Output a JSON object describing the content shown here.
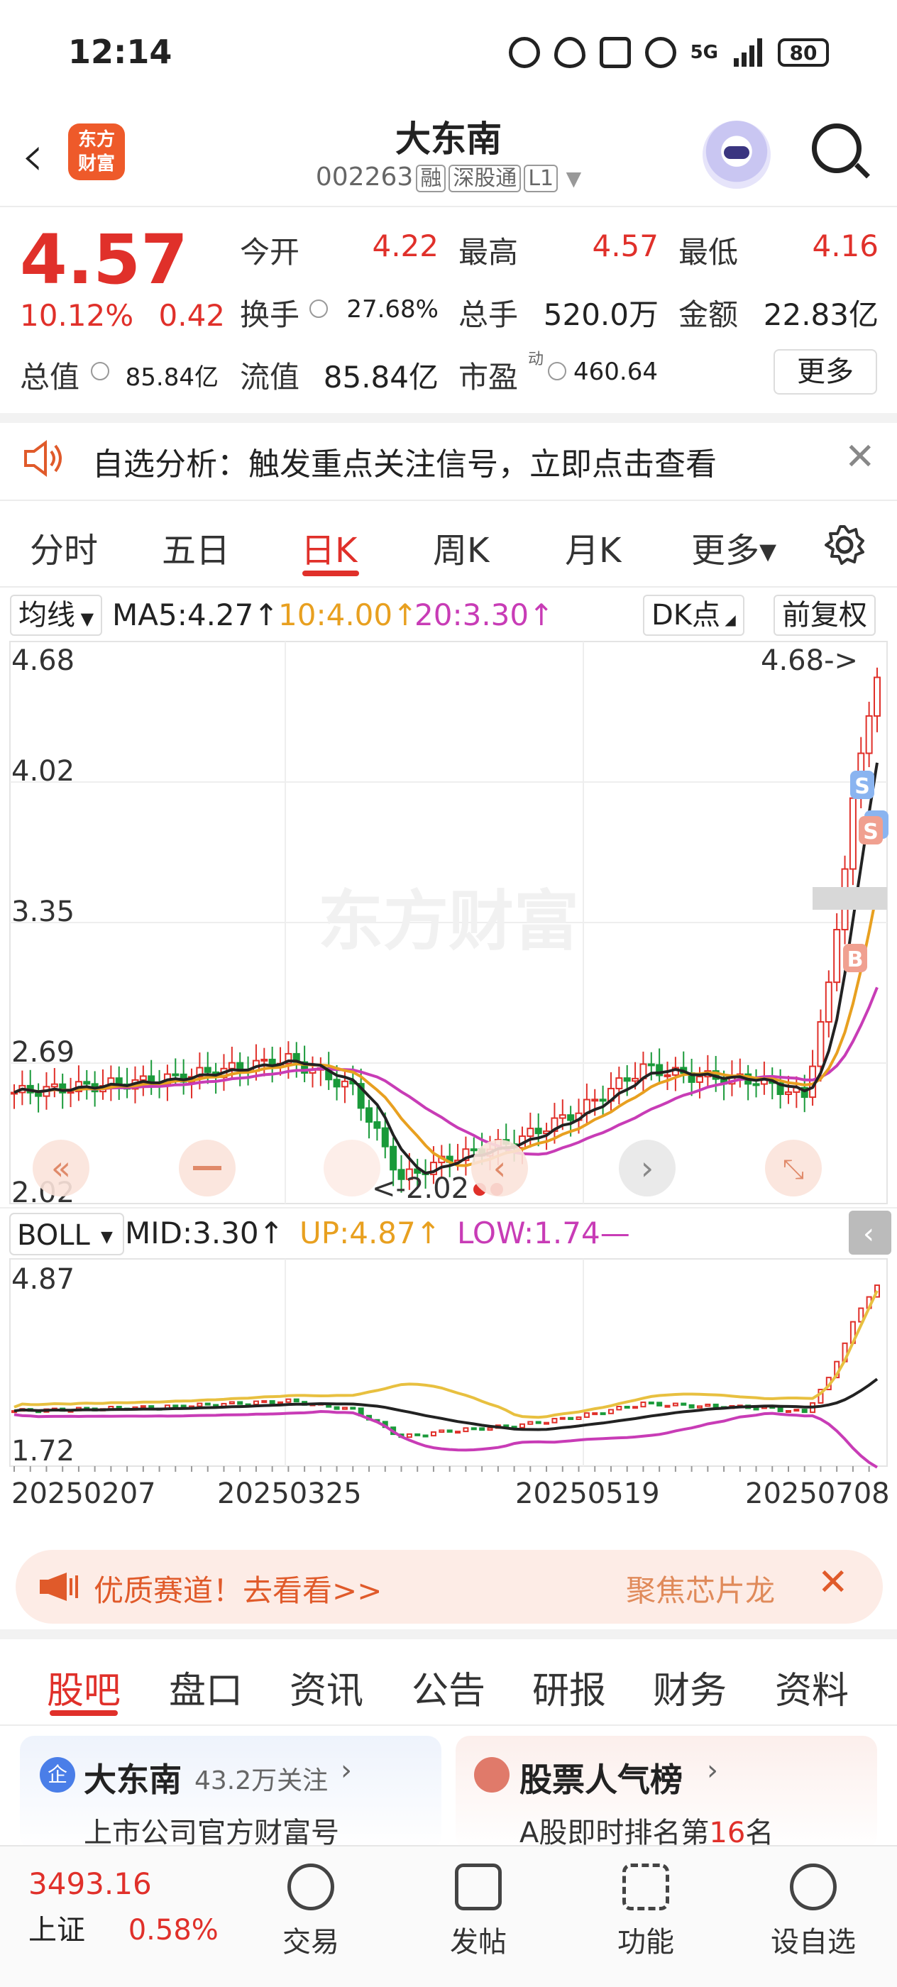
{
  "status_bar": {
    "time": "12:14",
    "network": "5G",
    "battery": "80"
  },
  "header": {
    "back_icon": "chevron-left-icon",
    "logo_line1": "东方",
    "logo_line2": "财富",
    "stock_name": "大东南",
    "stock_code": "002263",
    "tags": [
      "融",
      "深股通",
      "L1"
    ]
  },
  "quote": {
    "price": "4.57",
    "change_pct": "10.12%",
    "change_amt": "0.42",
    "open_label": "今开",
    "open": "4.22",
    "high_label": "最高",
    "high": "4.57",
    "low_label": "最低",
    "low": "4.16",
    "turnover_label": "换手",
    "turnover": "27.68%",
    "volume_label": "总手",
    "volume": "520.0万",
    "amount_label": "金额",
    "amount": "22.83亿",
    "mktcap_label": "总值",
    "mktcap": "85.84亿",
    "float_label": "流值",
    "float": "85.84亿",
    "pe_label": "市盈",
    "pe_sup": "动",
    "pe": "460.64",
    "more_label": "更多"
  },
  "alert": {
    "text": "自选分析：触发重点关注信号，立即点击查看"
  },
  "tabs": [
    "分时",
    "五日",
    "日K",
    "周K",
    "月K",
    "更多▾"
  ],
  "chart_toolbar": {
    "ma_select": "均线",
    "ma5": "MA5:4.27↑",
    "ma10": "10:4.00↑",
    "ma20": "20:3.30↑",
    "dk_button": "DK点",
    "adjust_button": "前复权"
  },
  "main_chart": {
    "y_labels": [
      "4.68",
      "4.02",
      "3.35",
      "2.69",
      "2.02"
    ],
    "max_annotation": "4.68->",
    "min_annotation": "<-2.02",
    "watermark": "东方财富",
    "signal_s": "S",
    "signal_b": "B"
  },
  "boll_toolbar": {
    "select": "BOLL",
    "mid": "MID:3.30↑",
    "up": "UP:4.87↑",
    "low": "LOW:1.74—"
  },
  "boll_chart": {
    "y_top": "4.87",
    "y_bottom": "1.72"
  },
  "x_dates": [
    "20250207",
    "20250325",
    "20250519",
    "20250708"
  ],
  "chart_data": {
    "type": "line",
    "title": "",
    "x": [
      "20250207",
      "20250325",
      "20250519",
      "20250708"
    ],
    "ylim": [
      2.02,
      4.68
    ],
    "series": [
      {
        "name": "MA5",
        "last": 4.27
      },
      {
        "name": "MA10",
        "last": 4.0
      },
      {
        "name": "MA20",
        "last": 3.3
      }
    ],
    "boll": {
      "mid": 3.3,
      "up": 4.87,
      "low": 1.74,
      "ylim": [
        1.72,
        4.87
      ]
    },
    "extremes": {
      "max": 4.68,
      "min": 2.02
    },
    "colors": {
      "up": "#e0302a",
      "down": "#1a9a3a",
      "ma5": "#222222",
      "ma10": "#e8a020",
      "ma20": "#c83cb6"
    }
  },
  "banner": {
    "left": "优质赛道！去看看>>",
    "right": "聚焦芯片龙"
  },
  "forum_tabs": [
    "股吧",
    "盘口",
    "资讯",
    "公告",
    "研报",
    "财务",
    "资料"
  ],
  "cards": {
    "company": {
      "badge": "企",
      "title": "大东南",
      "followers": "43.2万关注",
      "subtitle": "上市公司官方财富号"
    },
    "popularity": {
      "title": "股票人气榜",
      "subtitle_pre": "A股即时排名第",
      "rank": "16",
      "subtitle_post": "名"
    }
  },
  "bottom_bar": {
    "index_value": "3493.16",
    "index_name": "上证",
    "index_change": "0.58%",
    "items": [
      "交易",
      "发帖",
      "功能",
      "设自选"
    ]
  }
}
